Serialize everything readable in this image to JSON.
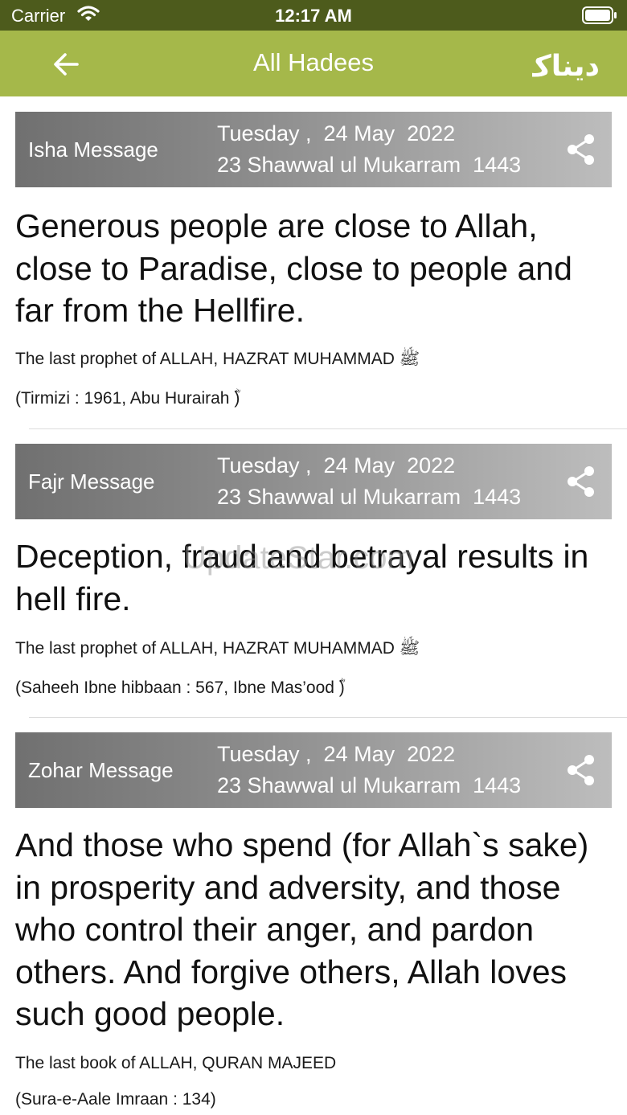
{
  "status": {
    "carrier": "Carrier",
    "time": "12:17 AM"
  },
  "nav": {
    "title": "All Hadees",
    "back_icon": "arrow-left-icon",
    "logo_text": "دیناک"
  },
  "messages": [
    {
      "type": "Isha Message",
      "date_gregorian": "Tuesday ,  24 May  2022",
      "date_hijri": "23 Shawwal ul Mukarram  1443",
      "text": "Generous people are close to Allah, close to Paradise, close to people and far from the Hellfire.",
      "source": "The last prophet of ALLAH, HAZRAT MUHAMMAD ﷺ",
      "reference": "(Tirmizi : 1961, Abu Hurairah ؓ)"
    },
    {
      "type": "Fajr Message",
      "date_gregorian": "Tuesday ,  24 May  2022",
      "date_hijri": "23 Shawwal ul Mukarram  1443",
      "text": "Deception, fraud and betrayal results in hell fire.",
      "source": "The last prophet of ALLAH, HAZRAT MUHAMMAD ﷺ",
      "reference": "(Saheeh Ibne hibbaan : 567, Ibne Mas’ood ؓ)"
    },
    {
      "type": "Zohar Message",
      "date_gregorian": "Tuesday ,  24 May  2022",
      "date_hijri": "23 Shawwal ul Mukarram  1443",
      "text": "And those who spend (for Allah`s sake) in prosperity and adversity, and those who control their anger, and pardon others. And forgive others, Allah loves such good people.",
      "source": "The last book of ALLAH, QURAN MAJEED",
      "reference": "(Sura-e-Aale Imraan : 134)"
    }
  ],
  "watermark": "UpdateStar.com",
  "colors": {
    "status_bar": "#4d5b1c",
    "nav_bar": "#a5b84a",
    "header_gradient_start": "#707070",
    "header_gradient_end": "#bdbdbd"
  }
}
